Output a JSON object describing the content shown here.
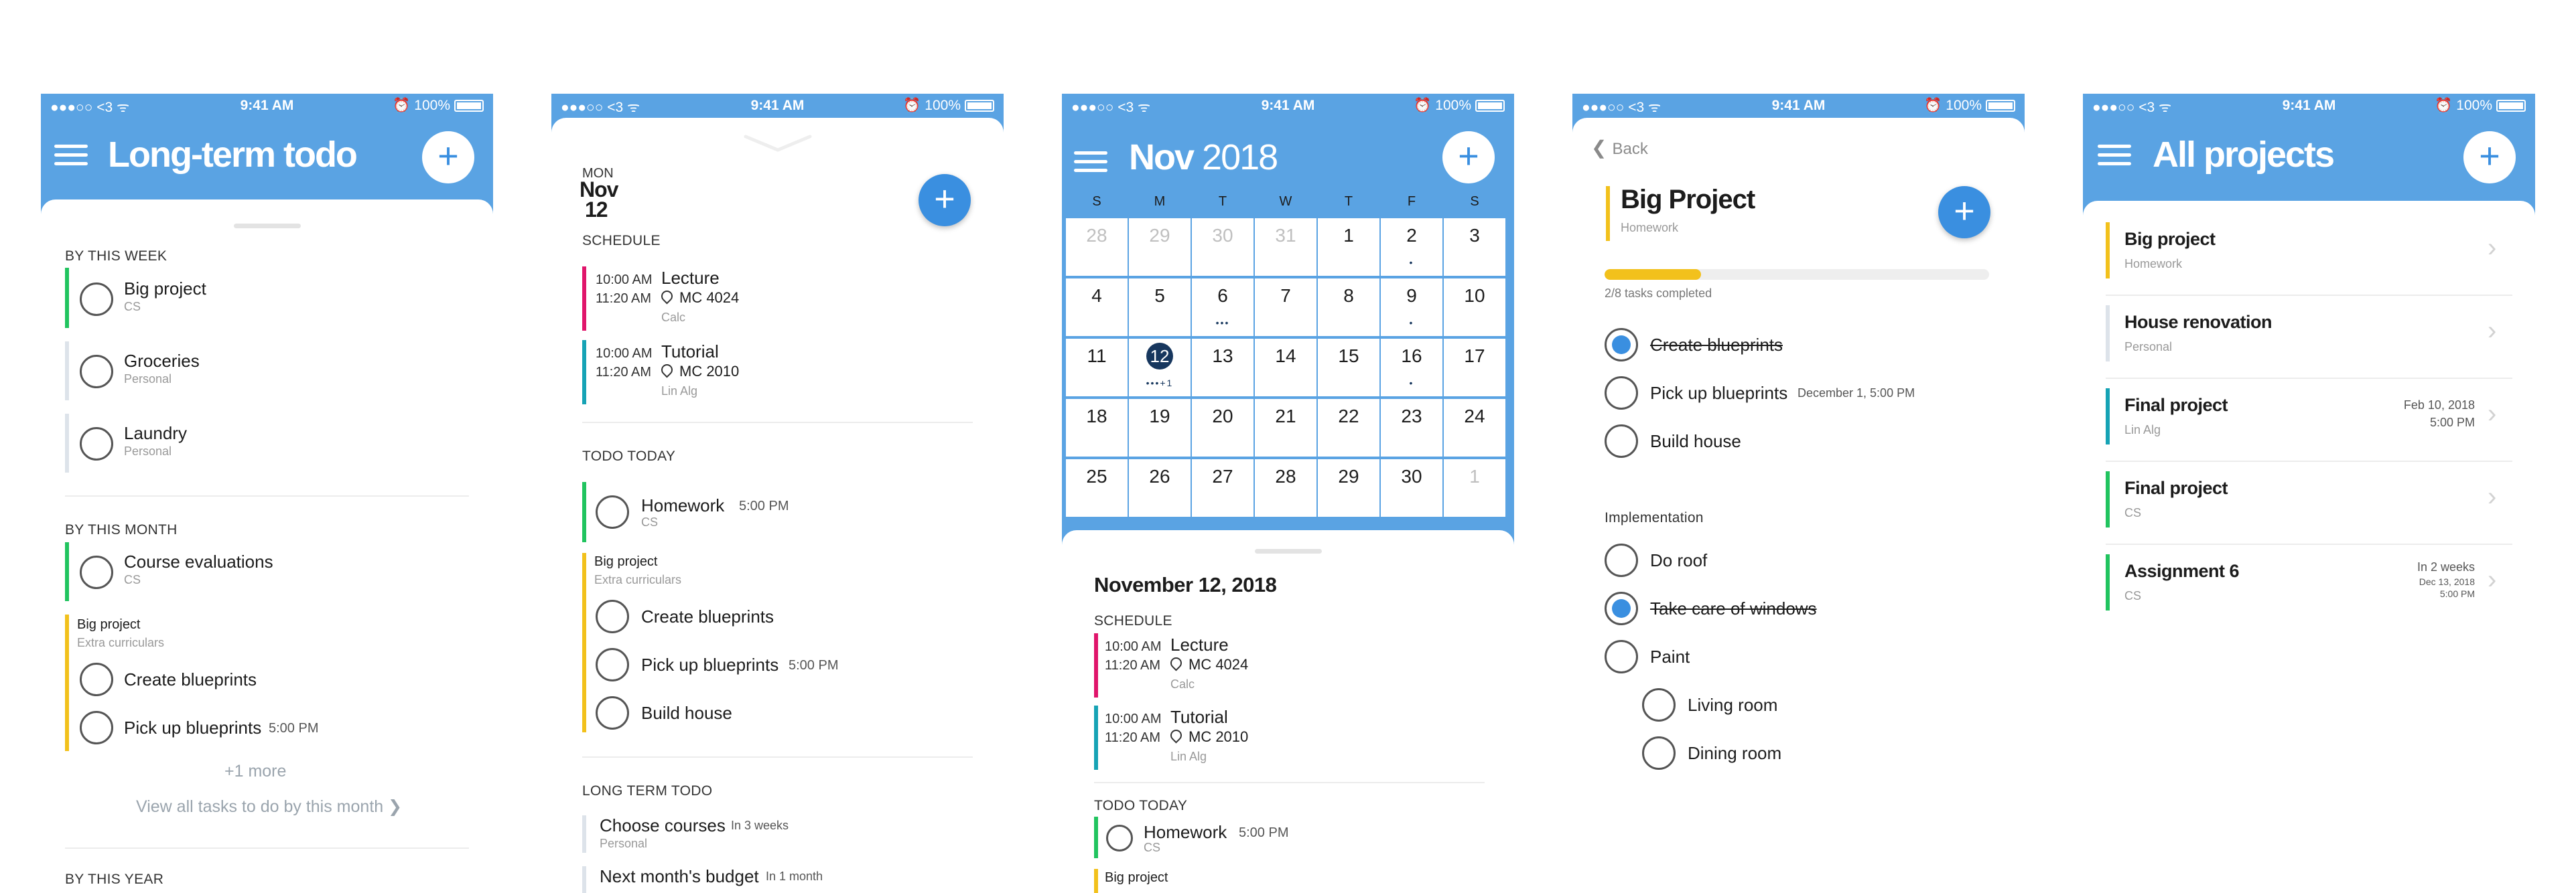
{
  "statusbar": {
    "carrier": "●●●○○ <3 ᯤ",
    "time": "9:41 AM",
    "battery": "⏰ 100%"
  },
  "colors": {
    "header": "#5aa3e3",
    "accent": "#3a8fe0",
    "green": "#21c45f",
    "yellow": "#f2c11c",
    "pink": "#e0156b",
    "teal": "#16a3b5",
    "grey_bar": "#dde3ea",
    "selected_day": "#17375e"
  },
  "screen1": {
    "title": "Long-term todo",
    "sections": {
      "week": "BY THIS WEEK",
      "month": "BY THIS MONTH",
      "year": "BY THIS YEAR"
    },
    "week_tasks": [
      {
        "title": "Big project",
        "sub": "CS"
      },
      {
        "title": "Groceries",
        "sub": "Personal"
      },
      {
        "title": "Laundry",
        "sub": "Personal"
      }
    ],
    "month_task": {
      "title": "Course evaluations",
      "sub": "CS"
    },
    "month_group": {
      "title": "Big project",
      "sub": "Extra curriculars"
    },
    "month_group_tasks": [
      {
        "title": "Create blueprints"
      },
      {
        "title": "Pick up blueprints",
        "time": "5:00 PM"
      }
    ],
    "more": "+1 more",
    "view_all": "View all tasks to do by this month ❯"
  },
  "screen2": {
    "day_name": "MON",
    "month": "Nov",
    "day": "12",
    "schedule_label": "SCHEDULE",
    "schedule": [
      {
        "start": "10:00 AM",
        "end": "11:20 AM",
        "name": "Lecture",
        "location": "MC 4024",
        "course": "Calc"
      },
      {
        "start": "10:00 AM",
        "end": "11:20 AM",
        "name": "Tutorial",
        "location": "MC 2010",
        "course": "Lin Alg"
      }
    ],
    "todo_label": "TODO TODAY",
    "todo_task": {
      "title": "Homework",
      "time": "5:00 PM",
      "sub": "CS"
    },
    "todo_group": {
      "title": "Big project",
      "sub": "Extra curriculars"
    },
    "todo_group_tasks": [
      {
        "title": "Create blueprints"
      },
      {
        "title": "Pick up blueprints",
        "time": "5:00 PM"
      },
      {
        "title": "Build house"
      }
    ],
    "long_label": "LONG TERM TODO",
    "long_tasks": [
      {
        "title": "Choose courses",
        "time": "In 3 weeks",
        "sub": "Personal"
      },
      {
        "title": "Next month's budget",
        "time": "In 1 month"
      }
    ]
  },
  "screen3": {
    "month": "Nov",
    "year": "2018",
    "weekdays": [
      "S",
      "M",
      "T",
      "W",
      "T",
      "F",
      "S"
    ],
    "days": [
      [
        "28",
        "29",
        "30",
        "31",
        "1",
        "2",
        "3"
      ],
      [
        "4",
        "5",
        "6",
        "7",
        "8",
        "9",
        "10"
      ],
      [
        "11",
        "12",
        "13",
        "14",
        "15",
        "16",
        "17"
      ],
      [
        "18",
        "19",
        "20",
        "21",
        "22",
        "23",
        "24"
      ],
      [
        "25",
        "26",
        "27",
        "28",
        "29",
        "30",
        "1"
      ]
    ],
    "dots": {
      "0-5": "•",
      "1-2": "•••",
      "1-5": "•",
      "2-1": "•••+1",
      "2-5": "•"
    },
    "date_title": "November 12, 2018",
    "schedule_label": "SCHEDULE",
    "schedule": [
      {
        "start": "10:00 AM",
        "end": "11:20 AM",
        "name": "Lecture",
        "location": "MC 4024",
        "course": "Calc"
      },
      {
        "start": "10:00 AM",
        "end": "11:20 AM",
        "name": "Tutorial",
        "location": "MC 2010",
        "course": "Lin Alg"
      }
    ],
    "todo_label": "TODO TODAY",
    "todo_task": {
      "title": "Homework",
      "time": "5:00 PM",
      "sub": "CS"
    },
    "todo_group": {
      "title": "Big project"
    }
  },
  "screen4": {
    "back": "Back",
    "title": "Big Project",
    "subtitle": "Homework",
    "progress_fraction": 0.25,
    "progress_label": "2/8 tasks completed",
    "tasks": [
      {
        "title": "Create blueprints",
        "done": true
      },
      {
        "title": "Pick up blueprints",
        "time": "December 1, 5:00 PM",
        "done": false
      },
      {
        "title": "Build house",
        "done": false
      }
    ],
    "group_label": "Implementation",
    "group_tasks": [
      {
        "title": "Do roof",
        "done": false
      },
      {
        "title": "Take care of windows",
        "done": true
      },
      {
        "title": "Paint",
        "done": false
      }
    ],
    "sub_tasks": [
      {
        "title": "Living room"
      },
      {
        "title": "Dining room"
      }
    ]
  },
  "screen5": {
    "title": "All projects",
    "projects": [
      {
        "title": "Big project",
        "sub": "Homework",
        "right1": "",
        "right2": ""
      },
      {
        "title": "House renovation",
        "sub": "Personal",
        "right1": "",
        "right2": ""
      },
      {
        "title": "Final project",
        "sub": "Lin Alg",
        "right1": "Feb 10, 2018",
        "right2": "5:00 PM"
      },
      {
        "title": "Final project",
        "sub": "CS",
        "right1": "",
        "right2": ""
      },
      {
        "title": "Assignment 6",
        "sub": "CS",
        "right1": "In 2 weeks",
        "right2": "Dec 13, 2018",
        "right3": "5:00 PM"
      }
    ]
  }
}
